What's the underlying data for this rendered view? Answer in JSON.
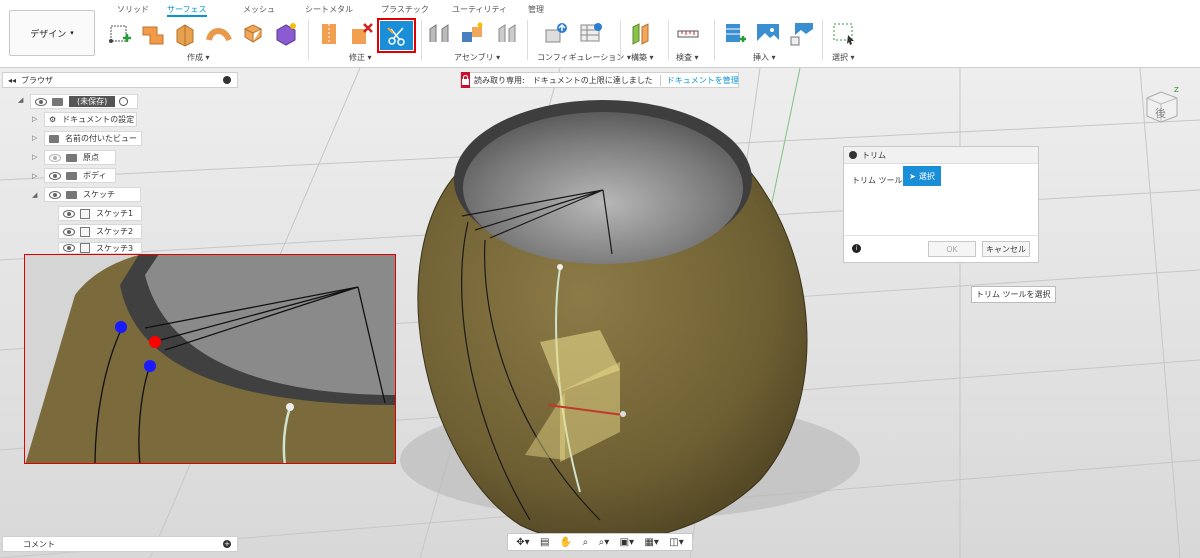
{
  "workspace": {
    "label": "デザイン",
    "caret": "▾"
  },
  "tabs": [
    {
      "label": "ソリッド"
    },
    {
      "label": "サーフェス"
    },
    {
      "label": "メッシュ"
    },
    {
      "label": "シートメタル"
    },
    {
      "label": "プラスチック"
    },
    {
      "label": "ユーティリティ"
    },
    {
      "label": "管理"
    }
  ],
  "groups": {
    "create": "作成 ▾",
    "modify": "修正 ▾",
    "assemble": "アセンブリ ▾",
    "configure": "コンフィギュレーション ▾",
    "construct": "構築 ▾",
    "inspect": "検査 ▾",
    "insert": "挿入 ▾",
    "select": "選択 ▾"
  },
  "browser": {
    "title": "ブラウザ",
    "collapse_glyph": "◂◂",
    "items": [
      {
        "label": "(未保存)"
      },
      {
        "label": "ドキュメントの設定"
      },
      {
        "label": "名前の付いたビュー"
      },
      {
        "label": "原点"
      },
      {
        "label": "ボディ"
      },
      {
        "label": "スケッチ"
      },
      {
        "label": "スケッチ1"
      },
      {
        "label": "スケッチ2"
      },
      {
        "label": "スケッチ3"
      }
    ]
  },
  "banner": {
    "readonly_label": "読み取り専用:",
    "message": "ドキュメントの上限に達しました",
    "manage_link": "ドキュメントを管理"
  },
  "trim_dialog": {
    "title": "トリム",
    "tool_label": "トリム ツール",
    "select_button": "選択",
    "ok": "OK",
    "cancel": "キャンセル",
    "info": "i"
  },
  "tooltip": "トリム ツールを選択",
  "comment": {
    "label": "コメント",
    "add": "+"
  },
  "viewcube": {
    "face_label": "後",
    "axis": "Z"
  },
  "colors": {
    "accent": "#0696d7",
    "highlight_red": "#e00000",
    "body_olive": "#7a6a3c",
    "point_blue": "#1a1aff",
    "point_red": "#ff0000"
  }
}
